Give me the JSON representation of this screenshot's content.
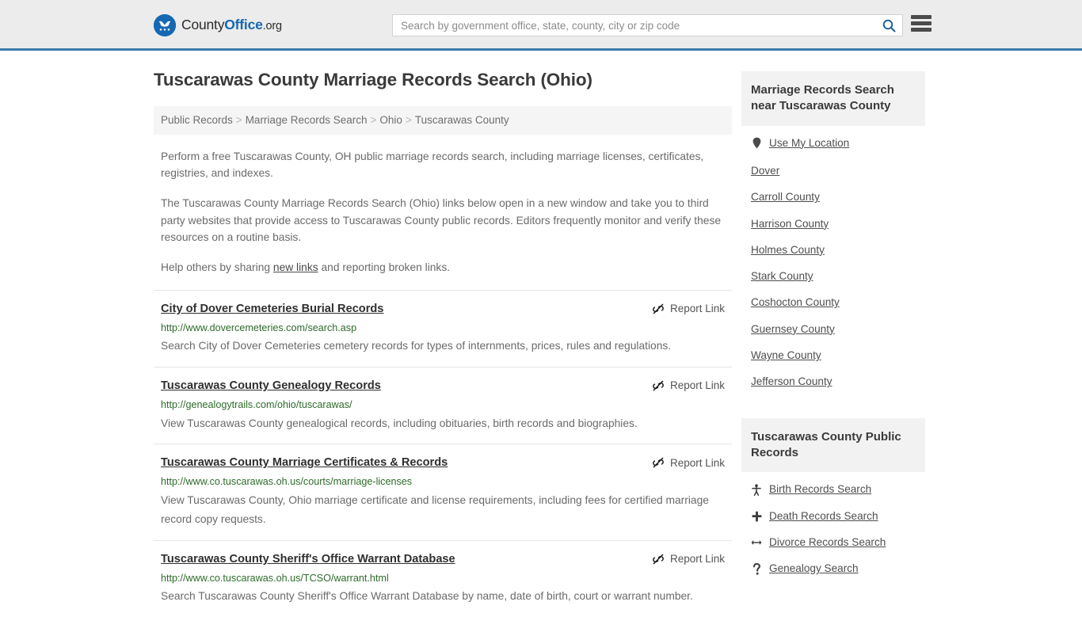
{
  "header": {
    "logo": {
      "icon": "eagle-seal-icon",
      "part1": "County",
      "part2": "Office",
      "part3": ".org"
    },
    "search": {
      "placeholder": "Search by government office, state, county, city or zip code",
      "value": "",
      "icon": "search-icon"
    },
    "menu_icon": "hamburger-menu-icon",
    "accent_color": "#3c7ca6",
    "background": "#ececec"
  },
  "main": {
    "page_title": "Tuscarawas County Marriage Records Search (Ohio)",
    "breadcrumb": [
      "Public Records",
      "Marriage Records Search",
      "Ohio",
      "Tuscarawas County"
    ],
    "breadcrumb_separator": ">",
    "intro": {
      "p1": "Perform a free Tuscarawas County, OH public marriage records search, including marriage licenses, certificates, registries, and indexes.",
      "p2": "The Tuscarawas County Marriage Records Search (Ohio) links below open in a new window and take you to third party websites that provide access to Tuscarawas County public records. Editors frequently monitor and verify these resources on a routine basis.",
      "p3_before": "Help others by sharing ",
      "p3_link": "new links",
      "p3_after": " and reporting broken links."
    },
    "report_link_label": "Report Link",
    "report_link_icon": "broken-link-icon",
    "url_color": "#2e6b2b",
    "entries": [
      {
        "title": "City of Dover Cemeteries Burial Records",
        "url": "http://www.dovercemeteries.com/search.asp",
        "description": "Search City of Dover Cemeteries cemetery records for types of internments, prices, rules and regulations."
      },
      {
        "title": "Tuscarawas County Genealogy Records",
        "url": "http://genealogytrails.com/ohio/tuscarawas/",
        "description": "View Tuscarawas County genealogical records, including obituaries, birth records and biographies."
      },
      {
        "title": "Tuscarawas County Marriage Certificates & Records",
        "url": "http://www.co.tuscarawas.oh.us/courts/marriage-licenses",
        "description": "View Tuscarawas County, Ohio marriage certificate and license requirements, including fees for certified marriage record copy requests."
      },
      {
        "title": "Tuscarawas County Sheriff's Office Warrant Database",
        "url": "http://www.co.tuscarawas.oh.us/TCSO/warrant.html",
        "description": "Search Tuscarawas County Sheriff's Office Warrant Database by name, date of birth, court or warrant number."
      }
    ]
  },
  "sidebar": {
    "nearby": {
      "header": "Marriage Records Search near Tuscarawas County",
      "use_my_location": {
        "label": "Use My Location",
        "icon": "map-pin-icon"
      },
      "places": [
        "Dover",
        "Carroll County",
        "Harrison County",
        "Holmes County",
        "Stark County",
        "Coshocton County",
        "Guernsey County",
        "Wayne County",
        "Jefferson County"
      ]
    },
    "public_records": {
      "header": "Tuscarawas County Public Records",
      "items": [
        {
          "label": "Birth Records Search",
          "icon": "baby-icon"
        },
        {
          "label": "Death Records Search",
          "icon": "cross-icon"
        },
        {
          "label": "Divorce Records Search",
          "icon": "left-right-arrow-icon"
        },
        {
          "label": "Genealogy Search",
          "icon": "question-mark-icon"
        }
      ]
    }
  }
}
